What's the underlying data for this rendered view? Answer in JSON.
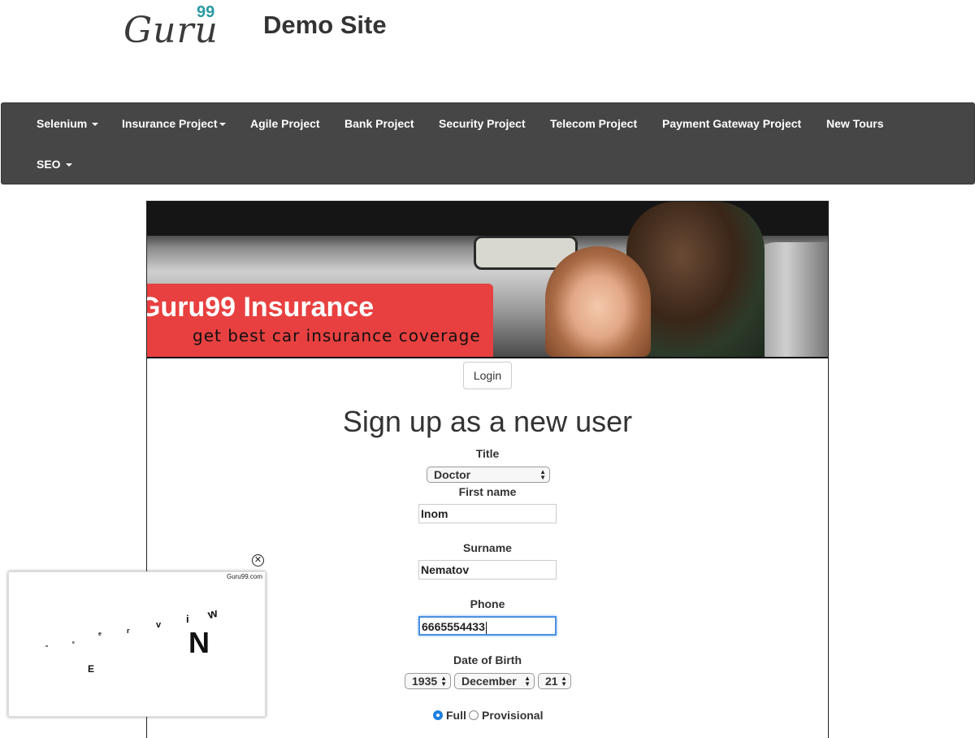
{
  "header": {
    "logo_text": "Guru",
    "logo_sup": "99",
    "site_title": "Demo Site"
  },
  "nav": {
    "items": [
      "Selenium",
      "Insurance Project",
      "Agile Project",
      "Bank Project",
      "Security Project",
      "Telecom Project",
      "Payment Gateway Project",
      "New Tours",
      "SEO"
    ]
  },
  "banner": {
    "title": "Guru99 Insurance",
    "subtitle": "get best car insurance coverage"
  },
  "login_label": "Login",
  "form": {
    "heading": "Sign up as a new user",
    "title_label": "Title",
    "title_value": "Doctor",
    "firstname_label": "First name",
    "firstname_value": "Inom",
    "surname_label": "Surname",
    "surname_value": "Nematov",
    "phone_label": "Phone",
    "phone_value": "6665554433",
    "dob_label": "Date of Birth",
    "dob_year": "1935",
    "dob_month": "December",
    "dob_day": "21",
    "license_full": "Full",
    "license_provisional": "Provisional"
  },
  "ad": {
    "source": "Guru99.com",
    "close_glyph": "✕",
    "letters": [
      "N",
      "e",
      "w",
      "v",
      "i",
      "e",
      "w",
      "E",
      "r"
    ]
  }
}
